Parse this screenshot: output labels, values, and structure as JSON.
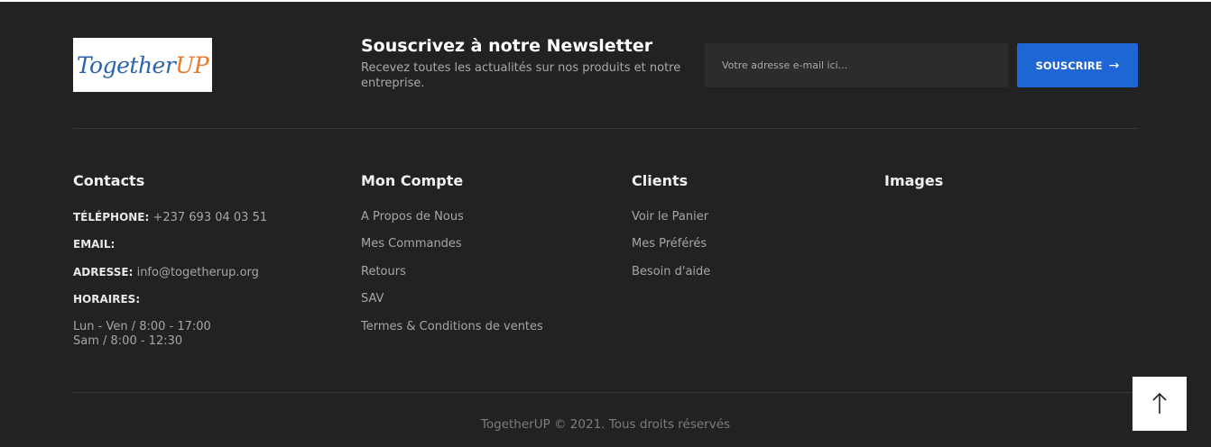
{
  "brand": {
    "logo_part1": "Together",
    "logo_part2": "UP"
  },
  "newsletter": {
    "title": "Souscrivez à notre Newsletter",
    "subtitle": "Recevez toutes les actualités sur nos produits et notre entreprise.",
    "placeholder": "Votre adresse e-mail ici...",
    "button_label": "SOUSCRIRE"
  },
  "contacts": {
    "title": "Contacts",
    "phone_label": "TÉLÉPHONE:",
    "phone_value": "+237 693 04 03 51",
    "email_label": "EMAIL:",
    "address_label": "ADRESSE:",
    "address_value": "info@togetherup.org",
    "hours_label": "HORAIRES:",
    "hours_weekday": "Lun - Ven / 8:00 - 17:00",
    "hours_saturday": "Sam / 8:00 - 12:30"
  },
  "account": {
    "title": "Mon Compte",
    "links": [
      "A Propos de Nous",
      "Mes Commandes",
      "Retours",
      "SAV",
      "Termes & Conditions de ventes"
    ]
  },
  "clients": {
    "title": "Clients",
    "links": [
      "Voir le Panier",
      "Mes Préférés",
      "Besoin d'aide"
    ]
  },
  "images": {
    "title": "Images"
  },
  "copyright": "TogetherUP © 2021. Tous droits réservés",
  "icons": {
    "submit": "arrow-right-icon",
    "scroll_top": "arrow-up-icon"
  },
  "colors": {
    "background": "#222222",
    "accent": "#1e66d4"
  }
}
